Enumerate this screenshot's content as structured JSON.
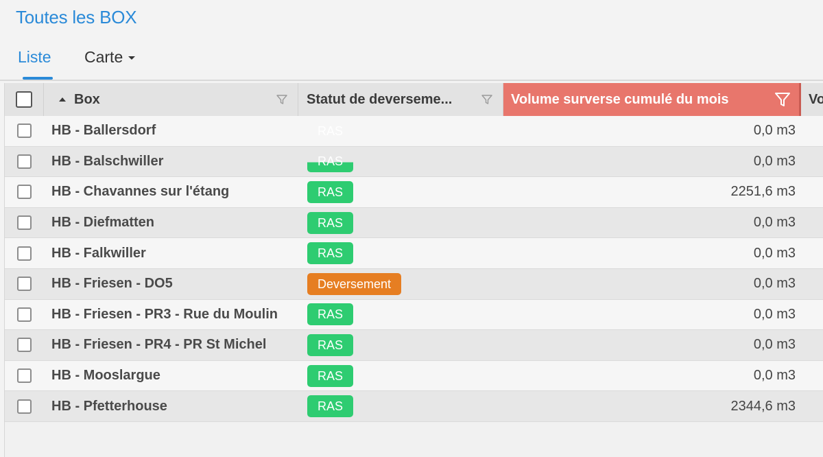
{
  "page": {
    "title": "Toutes les BOX"
  },
  "tabs": {
    "liste": "Liste",
    "carte": "Carte"
  },
  "table": {
    "columns": {
      "box": "Box",
      "statut": "Statut de deverseme...",
      "volume": "Volume surverse cumulé du mois",
      "next": "Vo"
    },
    "rows": [
      {
        "box": "HB - Ballersdorf",
        "statut": "RAS",
        "volume": "0,0 m3"
      },
      {
        "box": "HB - Balschwiller",
        "statut": "RAS",
        "volume": "0,0 m3"
      },
      {
        "box": "HB - Chavannes sur l'étang",
        "statut": "RAS",
        "volume": "2251,6 m3"
      },
      {
        "box": "HB - Diefmatten",
        "statut": "RAS",
        "volume": "0,0 m3"
      },
      {
        "box": "HB - Falkwiller",
        "statut": "RAS",
        "volume": "0,0 m3"
      },
      {
        "box": "HB - Friesen - DO5",
        "statut": "Deversement",
        "volume": "0,0 m3"
      },
      {
        "box": "HB - Friesen - PR3 - Rue du Moulin",
        "statut": "RAS",
        "volume": "0,0 m3"
      },
      {
        "box": "HB - Friesen - PR4 - PR St Michel",
        "statut": "RAS",
        "volume": "0,0 m3"
      },
      {
        "box": "HB - Mooslargue",
        "statut": "RAS",
        "volume": "0,0 m3"
      },
      {
        "box": "HB - Pfetterhouse",
        "statut": "RAS",
        "volume": "2344,6 m3"
      }
    ]
  },
  "colors": {
    "accent": "#2a8ad8",
    "status_ok": "#2ecc71",
    "status_alert": "#e67e22",
    "active_column": "#e8766c"
  },
  "icons": {
    "sort": "sort-ascending-icon",
    "filter": "filter-funnel-icon",
    "dropdown": "caret-down-icon"
  }
}
